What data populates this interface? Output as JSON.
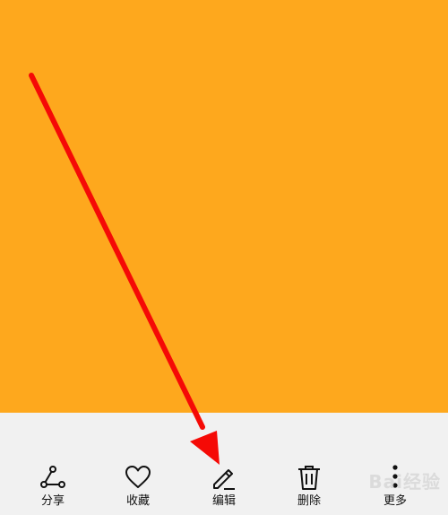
{
  "colors": {
    "photo_background": "#fea81d",
    "toolbar_background": "#f1f1f1",
    "arrow": "#f50a06",
    "icon_stroke": "#111111"
  },
  "toolbar": {
    "items": [
      {
        "label": "分享",
        "icon": "share-icon"
      },
      {
        "label": "收藏",
        "icon": "heart-icon"
      },
      {
        "label": "编辑",
        "icon": "pencil-icon"
      },
      {
        "label": "删除",
        "icon": "trash-icon"
      },
      {
        "label": "更多",
        "icon": "more-vertical-icon"
      }
    ]
  },
  "watermark": {
    "text": "Bai经验"
  }
}
